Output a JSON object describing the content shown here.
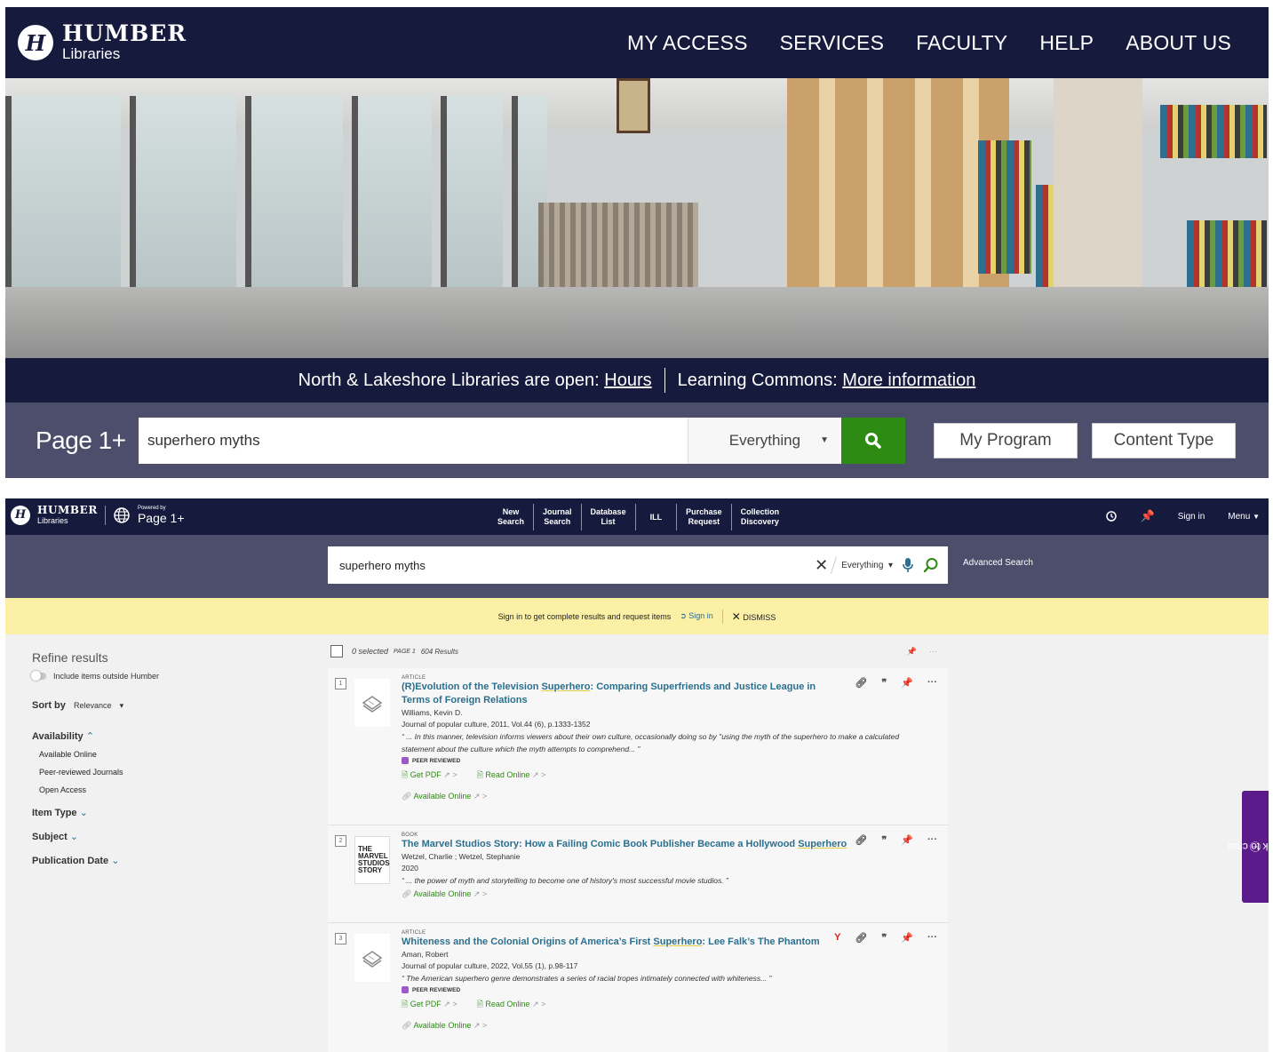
{
  "portal": {
    "logo": {
      "mark": "H",
      "name": "HUMBER",
      "sub": "Libraries"
    },
    "nav": [
      "MY ACCESS",
      "SERVICES",
      "FACULTY",
      "HELP",
      "ABOUT US"
    ],
    "notice": {
      "text1": "North & Lakeshore Libraries are open: ",
      "link1": "Hours",
      "text2": "Learning Commons: ",
      "link2": "More information"
    },
    "search": {
      "product": "Page 1+",
      "query": "superhero myths",
      "scope": "Everything",
      "btn_program": "My Program",
      "btn_content": "Content Type"
    }
  },
  "primo": {
    "brand": {
      "mark": "H",
      "name": "HUMBER",
      "sub": "Libraries",
      "powered": "Powered by",
      "product": "Page 1+"
    },
    "nav": [
      [
        "New",
        "Search"
      ],
      [
        "Journal",
        "Search"
      ],
      [
        "Database",
        "List"
      ],
      [
        "ILL",
        ""
      ],
      [
        "Purchase",
        "Request"
      ],
      [
        "Collection",
        "Discovery"
      ]
    ],
    "sign_in": "Sign in",
    "menu": "Menu",
    "search": {
      "query": "superhero myths",
      "scope": "Everything",
      "advanced": "Advanced Search"
    },
    "banner": {
      "text": "Sign in to get complete results and request items",
      "signin": "Sign in",
      "dismiss": "DISMISS"
    },
    "refine": {
      "heading": "Refine results",
      "toggle": "Include items outside Humber",
      "sort_label": "Sort by",
      "sort_value": "Relevance",
      "availability": "Availability",
      "availability_options": [
        "Available Online",
        "Peer-reviewed Journals",
        "Open Access"
      ],
      "item_type": "Item Type",
      "subject": "Subject",
      "pub_date": "Publication Date"
    },
    "results_header": {
      "selected": "0 selected",
      "page": "PAGE 1",
      "count": "604 Results"
    },
    "results": [
      {
        "num": "1",
        "type": "ARTICLE",
        "title_pre": "(R)Evolution of the Television ",
        "title_hl": "Superhero",
        "title_post": ": Comparing Superfriends and Justice League in Terms of Foreign Relations",
        "author": "Williams, Kevin D.",
        "source": "Journal of popular culture, 2011, Vol.44 (6), p.1333-1352",
        "snippet": "“ ... In this manner, television informs viewers about their own culture, occasionally doing so by \"using the myth of the superhero to make a calculated statement about the culture which the myth attempts to comprehend... ”",
        "peer": "PEER REVIEWED",
        "get_pdf": "Get PDF",
        "read_online": "Read Online",
        "available": "Available Online"
      },
      {
        "num": "2",
        "type": "BOOK",
        "title_pre": "The Marvel Studios Story: How a Failing Comic Book Publisher Became a Hollywood ",
        "title_hl": "Superhero",
        "title_post": "",
        "author": "Wetzel, Charlie ; Wetzel, Stephanie",
        "source": "2020",
        "snippet": "“ ... the power of myth and storytelling to become one of history's most successful movie studios. ”",
        "available": "Available Online",
        "cover": [
          "THE",
          "MARVEL",
          "STUDIOS",
          "STORY"
        ]
      },
      {
        "num": "3",
        "type": "ARTICLE",
        "title_pre": "Whiteness and the Colonial Origins of America’s First ",
        "title_hl": "Superhero",
        "title_post": ": Lee Falk’s The Phantom",
        "author": "Aman, Robert",
        "source": "Journal of popular culture, 2022, Vol.55 (1), p.98-117",
        "snippet": "“ The American superhero genre demonstrates a series of racial tropes intimately connected with whiteness... ”",
        "peer": "PEER REVIEWED",
        "get_pdf": "Get PDF",
        "read_online": "Read Online",
        "available": "Available Online"
      }
    ],
    "chat": "click to chat"
  }
}
